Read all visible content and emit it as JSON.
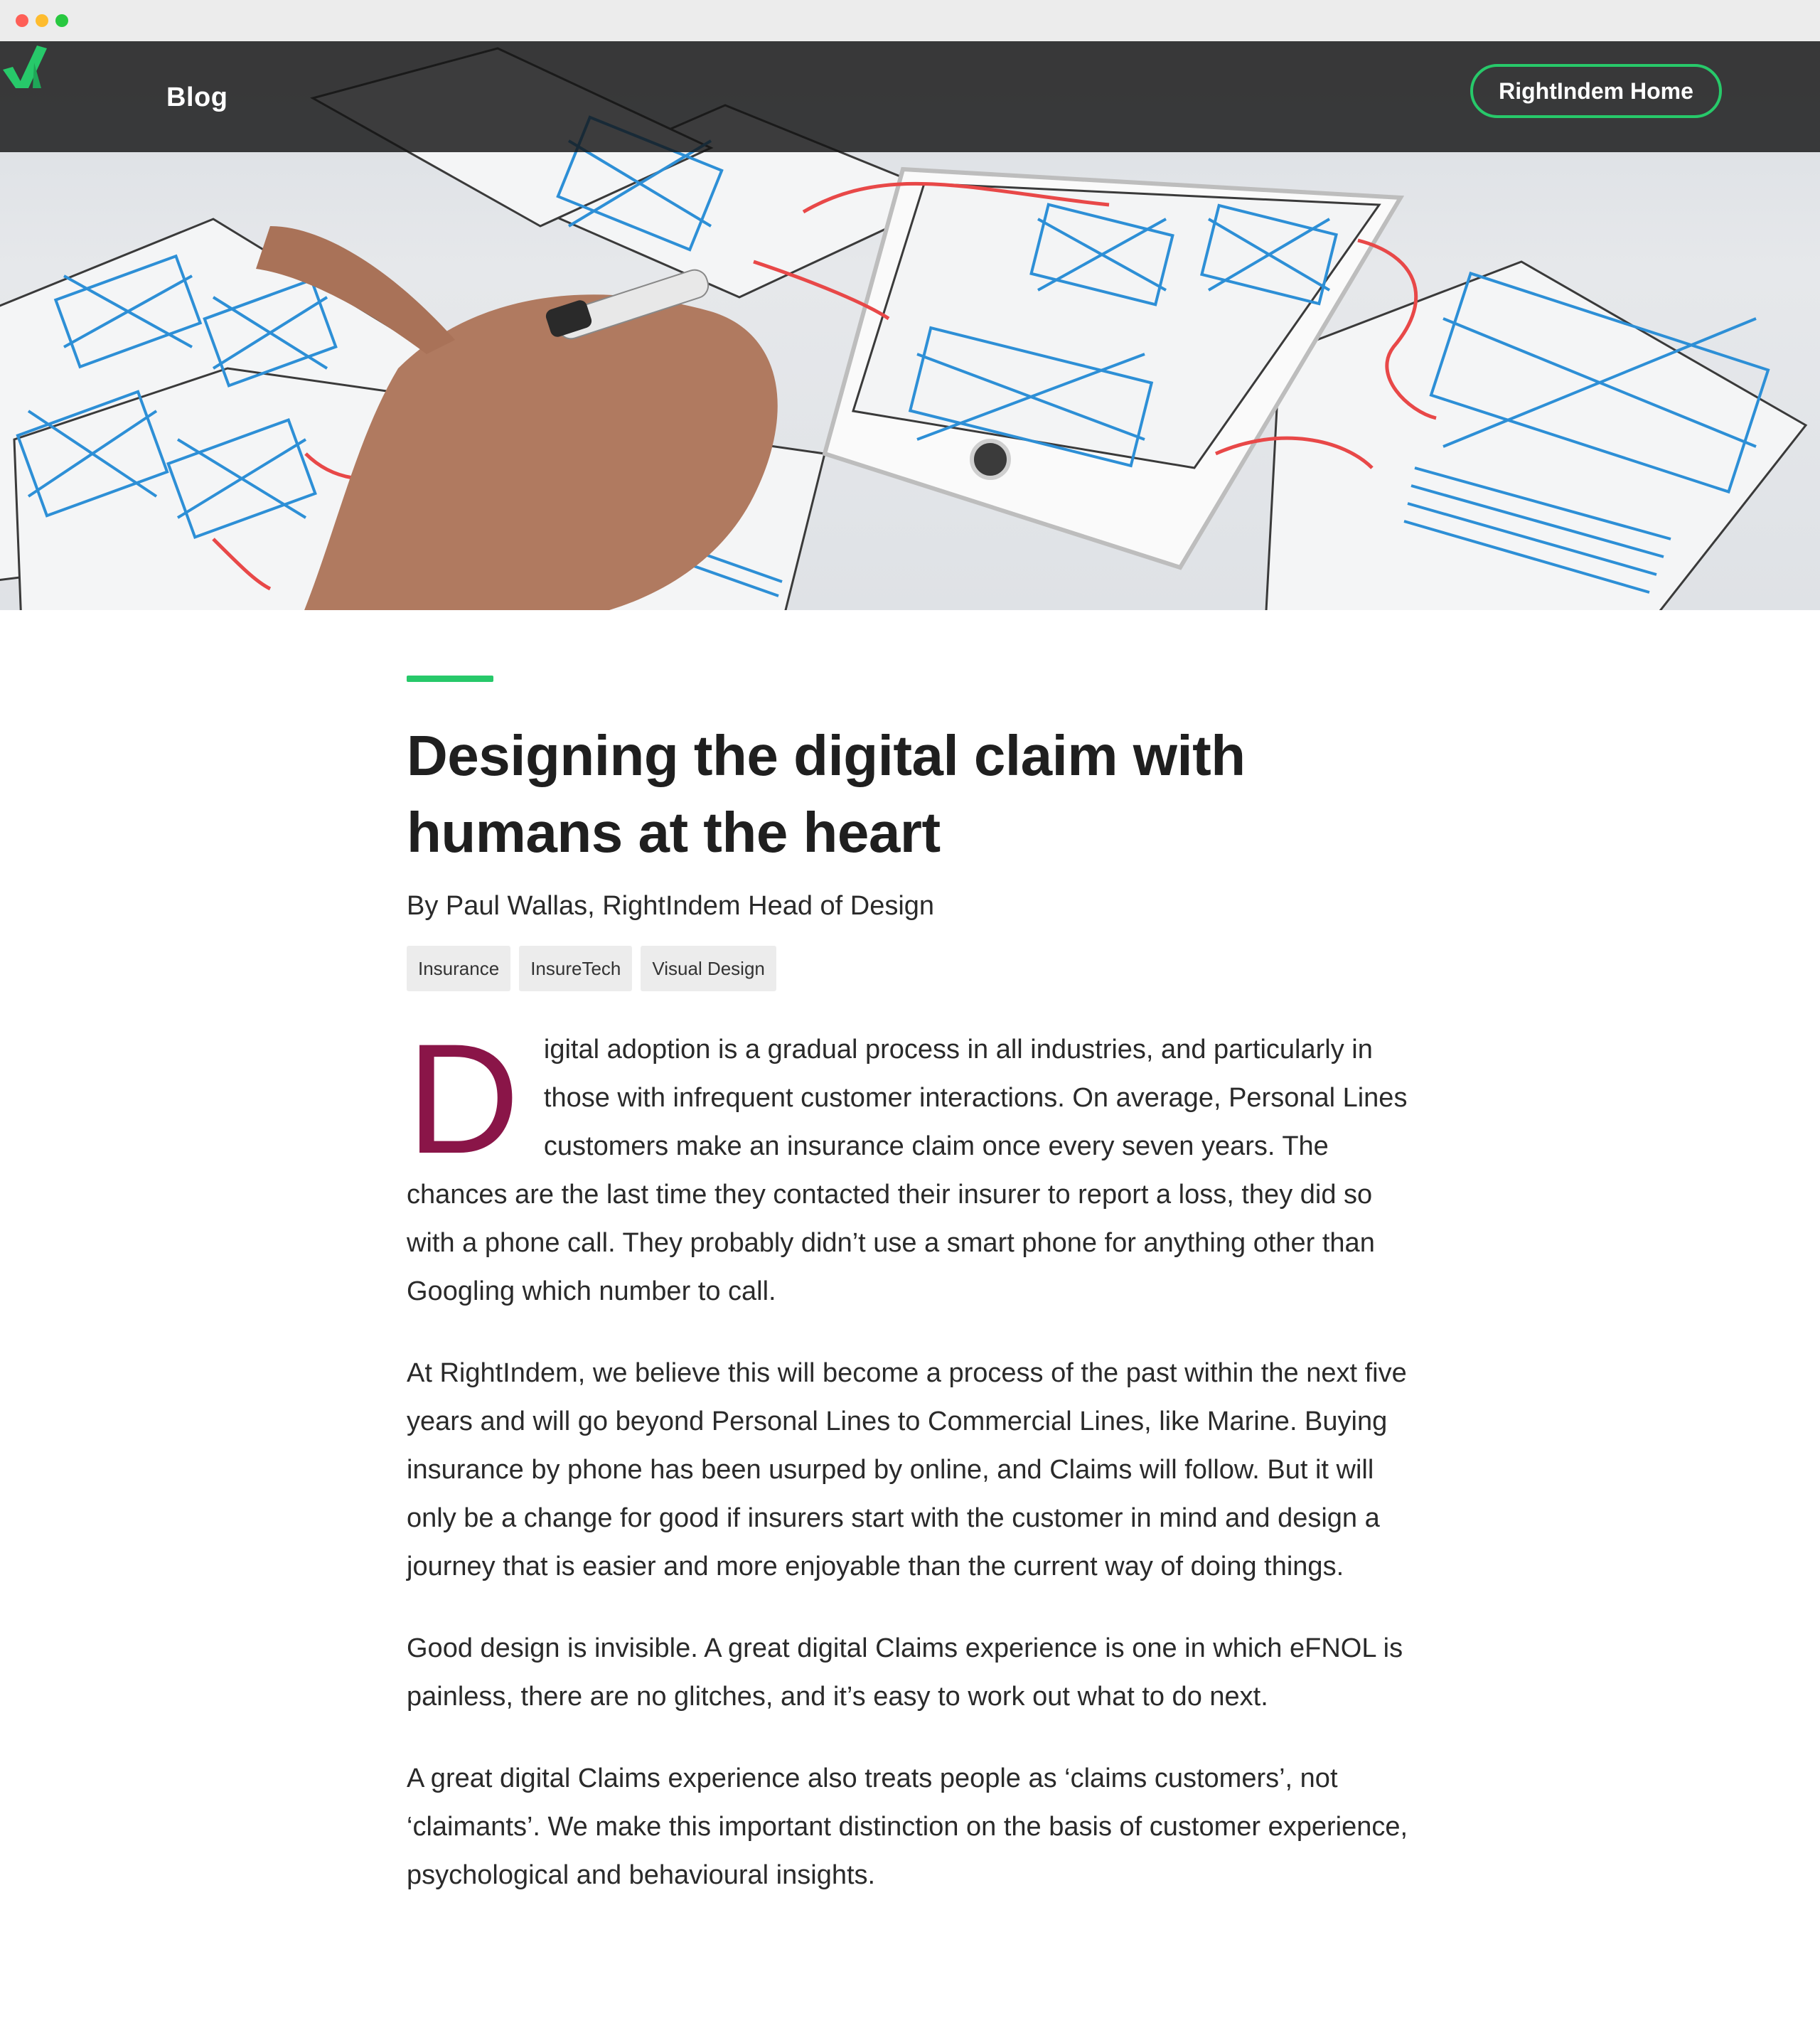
{
  "window": {
    "controls": [
      "close",
      "minimize",
      "zoom"
    ]
  },
  "header": {
    "logo_icon": "checkmark-logo-icon",
    "section_label": "Blog",
    "home_button_label": "RightIndem Home"
  },
  "hero": {
    "image_alt": "Hands sketching wireframes for a mobile app"
  },
  "article": {
    "title": "Designing the digital claim with humans at the heart",
    "byline": "By Paul Wallas, RightIndem Head of Design",
    "tags": [
      "Insurance",
      "InsureTech",
      "Visual Design"
    ],
    "dropcap": "D",
    "paragraphs": [
      "igital adoption is a gradual process in all industries, and particularly in those with infrequent customer interactions. On average, Personal Lines customers make an insurance claim once every seven years. The chances are the last time they contacted their insurer to report a loss, they did so with a phone call. They probably didn’t use a smart phone for anything other than Googling which number to call.",
      "At RightIndem, we believe this will become a process of the past within the next five years and will go beyond Personal Lines to Commercial Lines, like Marine. Buying insurance by phone has been usurped by online, and Claims will follow. But it will only be a change for good if insurers start with the customer in mind and design a journey that is easier and more enjoyable than the current way of doing things.",
      "Good design is invisible. A great digital Claims experience is one in which eFNOL is painless, there are no glitches, and it’s easy to work out what to do next.",
      "A great digital Claims experience also treats people as ‘claims customers’, not ‘claimants’. We make this important distinction on the basis of customer experience, psychological and behavioural insights."
    ]
  },
  "colors": {
    "accent": "#27c96a",
    "dropcap": "#8a1548",
    "navbar": "#141414"
  }
}
